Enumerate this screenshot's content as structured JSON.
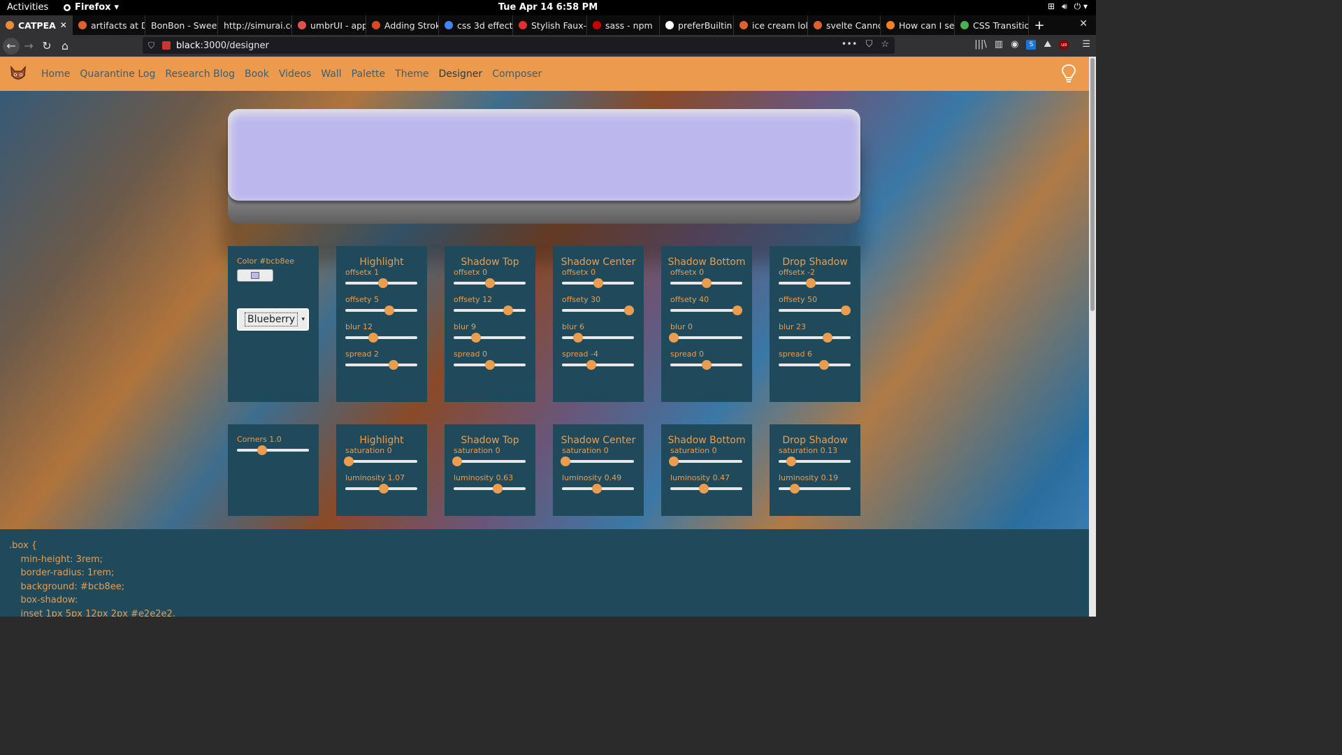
{
  "os": {
    "activities": "Activities",
    "app_menu": "Firefox",
    "clock": "Tue Apr 14   6:58 PM"
  },
  "browser": {
    "tabs": [
      {
        "title": "CATPEA",
        "color": "#e88c3a",
        "active": true
      },
      {
        "title": "artifacts at D",
        "color": "#e06030"
      },
      {
        "title": "BonBon - Sweet",
        "color": ""
      },
      {
        "title": "http://simurai.co",
        "color": ""
      },
      {
        "title": "umbrUI - app",
        "color": "#e05050"
      },
      {
        "title": "Adding Strok",
        "color": "#d84a20"
      },
      {
        "title": "css 3d effect",
        "color": "#4285f4"
      },
      {
        "title": "Stylish Faux-",
        "color": "#e03030"
      },
      {
        "title": "sass - npm",
        "color": "#cb0000"
      },
      {
        "title": "preferBuiltin",
        "color": "#ffffff"
      },
      {
        "title": "ice cream loll",
        "color": "#e06030"
      },
      {
        "title": "svelte Canno",
        "color": "#e06030"
      },
      {
        "title": "How can I set",
        "color": "#f48024"
      },
      {
        "title": "CSS Transitio",
        "color": "#4caf50"
      }
    ],
    "url_host": "black",
    "url_rest": ":3000/designer"
  },
  "site": {
    "nav": [
      "Home",
      "Quarantine Log",
      "Research Blog",
      "Book",
      "Videos",
      "Wall",
      "Palette",
      "Theme",
      "Designer",
      "Composer"
    ],
    "current": "Designer"
  },
  "color_panel": {
    "label": "Color #bcb8ee",
    "swatch": "#bcb8ee",
    "preset": "Blueberry"
  },
  "shadow_panels": [
    {
      "title": "Highlight",
      "controls": [
        {
          "name": "offsetx",
          "value": "1",
          "level": 0.52
        },
        {
          "name": "offsety",
          "value": "5",
          "level": 0.61
        },
        {
          "name": "blur",
          "value": "12",
          "level": 0.39
        },
        {
          "name": "spread",
          "value": "2",
          "level": 0.67
        }
      ]
    },
    {
      "title": "Shadow Top",
      "controls": [
        {
          "name": "offsetx",
          "value": "0",
          "level": 0.5
        },
        {
          "name": "offsety",
          "value": "12",
          "level": 0.76
        },
        {
          "name": "blur",
          "value": "9",
          "level": 0.31
        },
        {
          "name": "spread",
          "value": "0",
          "level": 0.5
        }
      ]
    },
    {
      "title": "Shadow Center",
      "controls": [
        {
          "name": "offsetx",
          "value": "0",
          "level": 0.5
        },
        {
          "name": "offsety",
          "value": "30",
          "level": 0.93
        },
        {
          "name": "blur",
          "value": "6",
          "level": 0.22
        },
        {
          "name": "spread",
          "value": "-4",
          "level": 0.41
        }
      ]
    },
    {
      "title": "Shadow Bottom",
      "controls": [
        {
          "name": "offsetx",
          "value": "0",
          "level": 0.5
        },
        {
          "name": "offsety",
          "value": "40",
          "level": 0.93
        },
        {
          "name": "blur",
          "value": "0",
          "level": 0.05
        },
        {
          "name": "spread",
          "value": "0",
          "level": 0.5
        }
      ]
    },
    {
      "title": "Drop Shadow",
      "controls": [
        {
          "name": "offsetx",
          "value": "-2",
          "level": 0.45
        },
        {
          "name": "offsety",
          "value": "50",
          "level": 0.93
        },
        {
          "name": "blur",
          "value": "23",
          "level": 0.68
        },
        {
          "name": "spread",
          "value": "6",
          "level": 0.63
        }
      ]
    }
  ],
  "corners_panel": {
    "label": "Corners 1.0",
    "level": 0.35
  },
  "color_panels": [
    {
      "title": "Highlight",
      "controls": [
        {
          "name": "saturation",
          "value": "0",
          "level": 0.05
        },
        {
          "name": "luminosity",
          "value": "1.07",
          "level": 0.53
        }
      ]
    },
    {
      "title": "Shadow Top",
      "controls": [
        {
          "name": "saturation",
          "value": "0",
          "level": 0.05
        },
        {
          "name": "luminosity",
          "value": "0.63",
          "level": 0.61
        }
      ]
    },
    {
      "title": "Shadow Center",
      "controls": [
        {
          "name": "saturation",
          "value": "0",
          "level": 0.05
        },
        {
          "name": "luminosity",
          "value": "0.49",
          "level": 0.49
        }
      ]
    },
    {
      "title": "Shadow Bottom",
      "controls": [
        {
          "name": "saturation",
          "value": "0",
          "level": 0.05
        },
        {
          "name": "luminosity",
          "value": "0.47",
          "level": 0.47
        }
      ]
    },
    {
      "title": "Drop Shadow",
      "controls": [
        {
          "name": "saturation",
          "value": "0.13",
          "level": 0.17
        },
        {
          "name": "luminosity",
          "value": "0.19",
          "level": 0.22
        }
      ]
    }
  ],
  "code_lines": [
    ".box {",
    "    min-height: 3rem;",
    "    border-radius: 1rem;",
    "    background: #bcb8ee;",
    "    box-shadow:",
    "    inset 1px 5px 12px 2px #e2e2e2,"
  ],
  "colors": {
    "nav_bg": "#ec9a4d",
    "panel_bg": "#1f4a5c",
    "accent": "#eb9d4f"
  }
}
